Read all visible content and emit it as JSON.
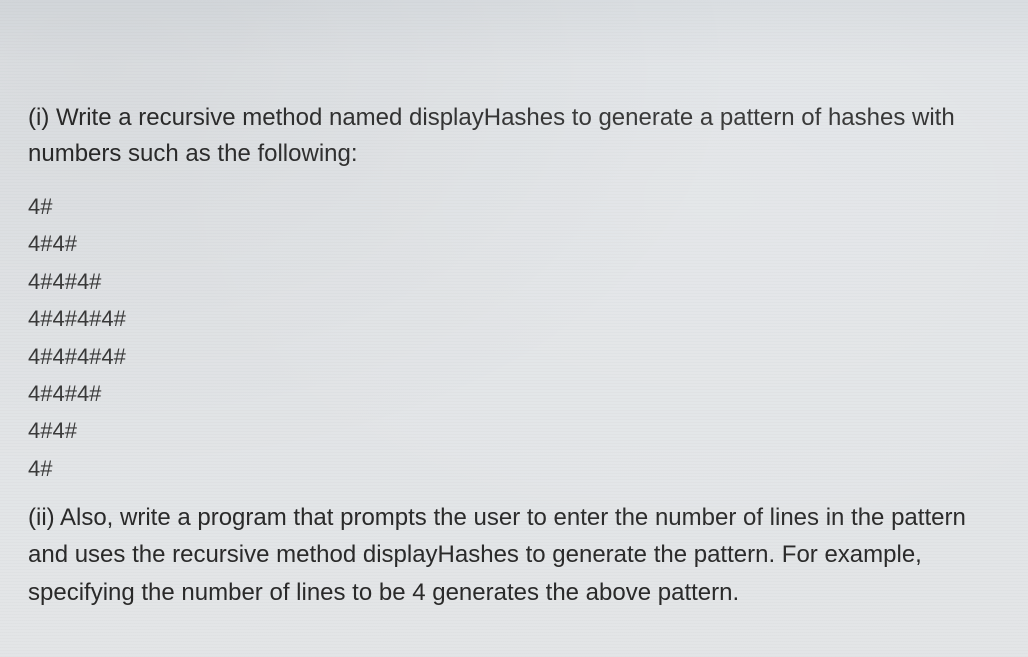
{
  "question": {
    "part_i": "(i)  Write a recursive method named displayHashes to generate a pattern of hashes with numbers such as the following:",
    "pattern_lines": [
      "4#",
      "4#4#",
      "4#4#4#",
      "4#4#4#4#",
      "4#4#4#4#",
      "4#4#4#",
      "4#4#",
      "4#"
    ],
    "part_ii": "(ii) Also, write a program that prompts the user to enter the number of lines in the pattern and uses the recursive method displayHashes to generate the pattern. For example, specifying the number of lines to be 4 generates the above pattern."
  }
}
